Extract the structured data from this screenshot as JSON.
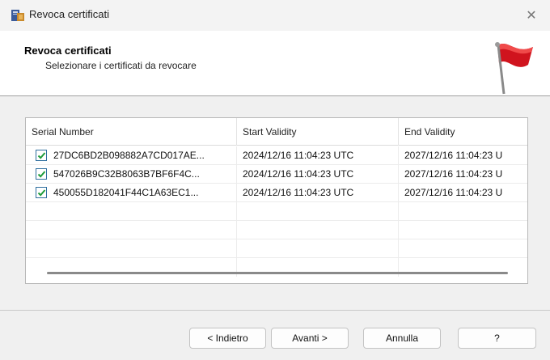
{
  "window": {
    "title": "Revoca certificati",
    "close_glyph": "✕"
  },
  "header": {
    "title": "Revoca certificati",
    "subtitle": "Selezionare i certificati da revocare",
    "icon": "red-flag-icon"
  },
  "table": {
    "columns": [
      "Serial Number",
      "Start Validity",
      "End Validity"
    ],
    "rows": [
      {
        "checked": true,
        "serial": "27DC6BD2B098882A7CD017AE...",
        "start": "2024/12/16 11:04:23 UTC",
        "end": "2027/12/16 11:04:23 U"
      },
      {
        "checked": true,
        "serial": "547026B9C32B8063B7BF6F4C...",
        "start": "2024/12/16 11:04:23 UTC",
        "end": "2027/12/16 11:04:23 U"
      },
      {
        "checked": true,
        "serial": "450055D182041F44C1A63EC1...",
        "start": "2024/12/16 11:04:23 UTC",
        "end": "2027/12/16 11:04:23 U"
      }
    ]
  },
  "buttons": {
    "back": "< Indietro",
    "next": "Avanti >",
    "cancel": "Annulla",
    "help": "?"
  },
  "colors": {
    "checkmark": "#1e9c3a",
    "flag": "#d0141e"
  }
}
